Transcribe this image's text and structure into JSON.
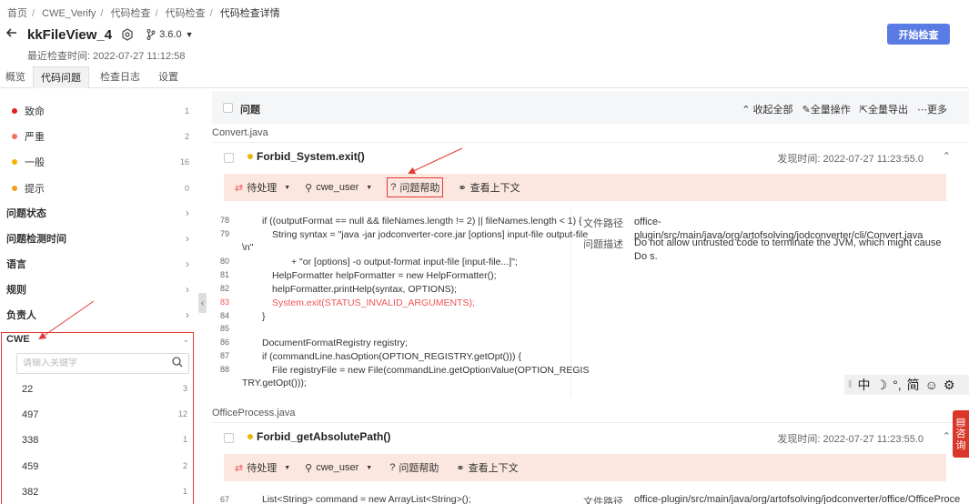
{
  "breadcrumb": [
    "首页",
    "CWE_Verify",
    "代码检查",
    "代码检查",
    "代码检查详情"
  ],
  "header": {
    "title": "kkFileView_4",
    "branch": "3.6.0",
    "last_check": "最近检查时间: 2022-07-27 11:12:58",
    "start_button": "开始检查"
  },
  "tabs": [
    "概览",
    "代码问题",
    "检查日志",
    "设置"
  ],
  "active_tab": "代码问题",
  "severities": [
    {
      "label": "致命",
      "count": "1",
      "color": "#e02020"
    },
    {
      "label": "严重",
      "count": "2",
      "color": "#f07060"
    },
    {
      "label": "一般",
      "count": "16",
      "color": "#f0b400"
    },
    {
      "label": "提示",
      "count": "0",
      "color": "#f0a020"
    }
  ],
  "filters": [
    "问题状态",
    "问题检测时间",
    "语言",
    "规则",
    "负责人"
  ],
  "cwe": {
    "label": "CWE",
    "search_placeholder": "请输入关键字",
    "items": [
      {
        "id": "22",
        "count": "3"
      },
      {
        "id": "497",
        "count": "12"
      },
      {
        "id": "338",
        "count": "1"
      },
      {
        "id": "459",
        "count": "2"
      },
      {
        "id": "382",
        "count": "1"
      }
    ]
  },
  "main_header": {
    "label": "问题",
    "collapse_all": "收起全部",
    "batch_ops": "全量操作",
    "export_all": "全量导出",
    "more": "更多"
  },
  "issues": [
    {
      "file": "Convert.java",
      "rule": "Forbid_System.exit()",
      "found_time": "发现时间:  2022-07-27 11:23:55.0",
      "status": "待处理",
      "owner": "cwe_user",
      "help": "问题帮助",
      "context": "查看上下文",
      "path_label": "文件路径",
      "path": "office-plugin/src/main/java/org/artofsolving/jodconverter/cli/Convert.java",
      "desc_label": "问题描述",
      "desc": "Do not allow untrusted code to terminate the JVM, which might cause Do s."
    },
    {
      "file": "OfficeProcess.java",
      "rule": "Forbid_getAbsolutePath()",
      "found_time": "发现时间:  2022-07-27 11:23:55.0",
      "status": "待处理",
      "owner": "cwe_user",
      "help": "问题帮助",
      "context": "查看上下文",
      "path_label": "文件路径",
      "path": "office-plugin/src/main/java/org/artofsolving/jodconverter/office/OfficeProce",
      "first_line_no": "67",
      "first_line": "List<String> command = new ArrayList<String>();"
    }
  ],
  "code_lines": [
    {
      "no": "78",
      "text": "if ((outputFormat == null && fileNames.length != 2) || fileNames.length < 1) {"
    },
    {
      "no": "79",
      "text": "String syntax = \"java -jar jodconverter-core.jar [options] input-file output-file"
    },
    {
      "no": "",
      "text": "\\n\""
    },
    {
      "no": "80",
      "text": "+ \"or [options] -o output-format input-file [input-file...]\";"
    },
    {
      "no": "81",
      "text": "HelpFormatter helpFormatter = new HelpFormatter();"
    },
    {
      "no": "82",
      "text": "helpFormatter.printHelp(syntax, OPTIONS);"
    },
    {
      "no": "83",
      "text": "System.exit(STATUS_INVALID_ARGUMENTS);"
    },
    {
      "no": "84",
      "text": "}"
    },
    {
      "no": "85",
      "text": ""
    },
    {
      "no": "86",
      "text": "DocumentFormatRegistry registry;"
    },
    {
      "no": "87",
      "text": "if (commandLine.hasOption(OPTION_REGISTRY.getOpt())) {"
    },
    {
      "no": "88",
      "text": "File registryFile = new File(commandLine.getOptionValue(OPTION_REGIS"
    },
    {
      "no": "",
      "text": "TRY.getOpt()));"
    }
  ],
  "ime": [
    "中",
    "☽",
    "°,",
    "简",
    "☺",
    "⚙"
  ],
  "consult": [
    "咨",
    "询"
  ]
}
